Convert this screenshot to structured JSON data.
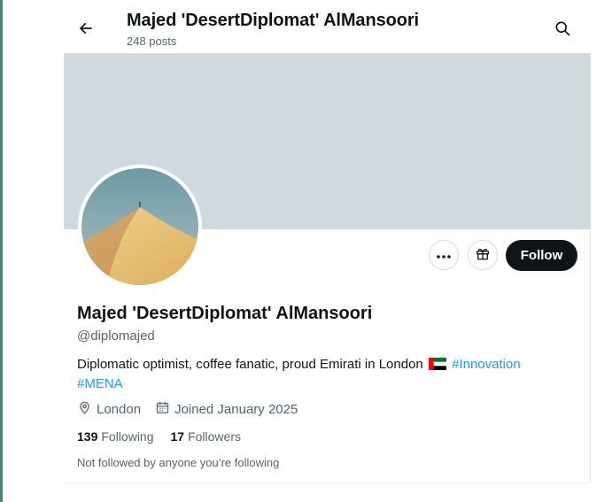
{
  "header": {
    "title": "Majed 'DesertDiplomat' AlMansoori",
    "post_count": "248 posts",
    "back_icon": "arrow-left-icon",
    "search_icon": "search-icon"
  },
  "profile": {
    "display_name": "Majed 'DesertDiplomat' AlMansoori",
    "handle": "@diplomajed",
    "bio_text": "Diplomatic optimist, coffee fanatic, proud Emirati in London",
    "bio_flag": "uae-flag-icon",
    "hashtags": [
      "#Innovation",
      "#MENA"
    ],
    "location": "London",
    "joined": "Joined January 2025",
    "following_count": "139",
    "following_label": "Following",
    "followers_count": "17",
    "followers_label": "Followers",
    "not_followed_text": "Not followed by anyone you’re following"
  },
  "actions": {
    "more_icon": "more-options-icon",
    "gift_icon": "gift-icon",
    "follow_label": "Follow"
  },
  "colors": {
    "banner": "#cfd9de",
    "accent_link": "#1d9bf0",
    "follow_button_bg": "#0f1419",
    "secondary_text": "#536471"
  }
}
